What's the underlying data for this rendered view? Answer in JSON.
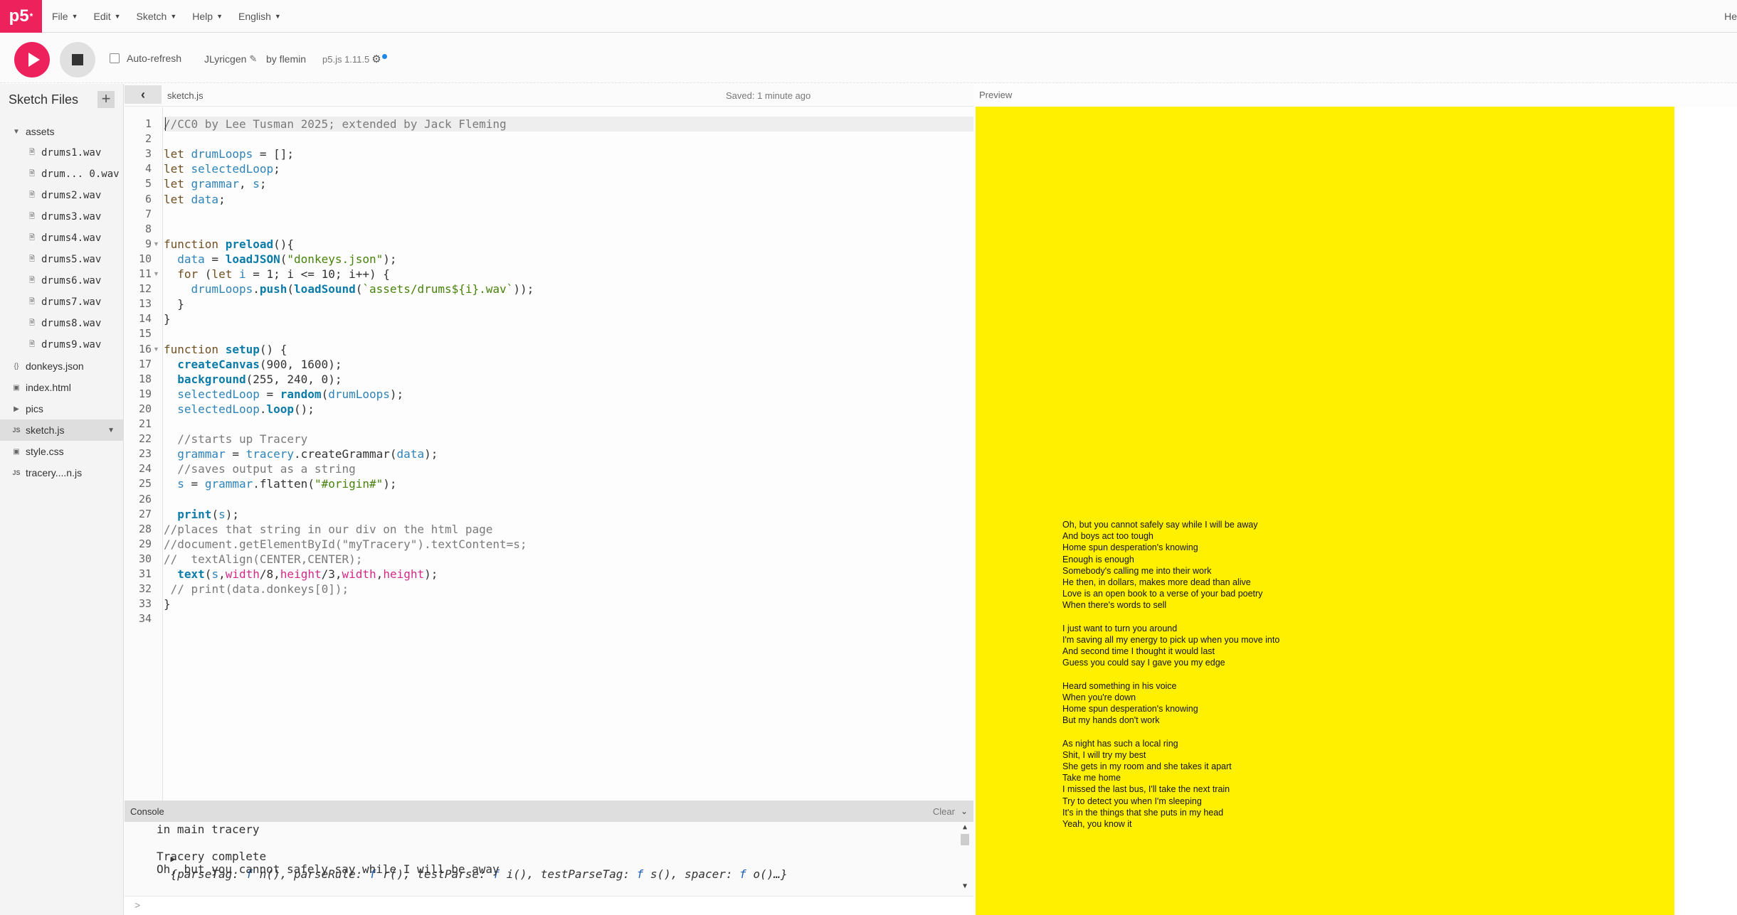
{
  "nav": {
    "logo": "p5",
    "logo_mark": "*",
    "menus": [
      "File",
      "Edit",
      "Sketch",
      "Help",
      "English"
    ],
    "right_text": "He"
  },
  "toolbar": {
    "autorefresh_label": "Auto-refresh",
    "sketch_name": "JLyricgen",
    "by_author": "by flemin",
    "version": "p5.js 1.11.5"
  },
  "sidebar": {
    "title": "Sketch Files",
    "add_label": "+",
    "files": [
      {
        "name": "assets",
        "type": "folder-open",
        "indent": 0
      },
      {
        "name": "drums1.wav",
        "type": "file",
        "indent": 1
      },
      {
        "name": "drum... 0.wav",
        "type": "file",
        "indent": 1
      },
      {
        "name": "drums2.wav",
        "type": "file",
        "indent": 1
      },
      {
        "name": "drums3.wav",
        "type": "file",
        "indent": 1
      },
      {
        "name": "drums4.wav",
        "type": "file",
        "indent": 1
      },
      {
        "name": "drums5.wav",
        "type": "file",
        "indent": 1
      },
      {
        "name": "drums6.wav",
        "type": "file",
        "indent": 1
      },
      {
        "name": "drums7.wav",
        "type": "file",
        "indent": 1
      },
      {
        "name": "drums8.wav",
        "type": "file",
        "indent": 1
      },
      {
        "name": "drums9.wav",
        "type": "file",
        "indent": 1
      },
      {
        "name": "donkeys.json",
        "type": "json",
        "indent": 0
      },
      {
        "name": "index.html",
        "type": "html",
        "indent": 0
      },
      {
        "name": "pics",
        "type": "folder-closed",
        "indent": 0
      },
      {
        "name": "sketch.js",
        "type": "js",
        "indent": 0,
        "selected": true
      },
      {
        "name": "style.css",
        "type": "css",
        "indent": 0
      },
      {
        "name": "tracery....n.js",
        "type": "js",
        "indent": 0
      }
    ]
  },
  "editor": {
    "tab": "sketch.js",
    "saved_status": "Saved: 1 minute ago",
    "active_line": 1,
    "fold_lines": [
      9,
      11,
      16
    ],
    "lines": [
      [
        [
          "cm",
          "//CC0 by Lee Tusman 2025; extended by Jack Fleming"
        ]
      ],
      [],
      [
        [
          "kw",
          "let "
        ],
        [
          "var",
          "drumLoops"
        ],
        [
          "plain",
          " = [];"
        ]
      ],
      [
        [
          "kw",
          "let "
        ],
        [
          "var",
          "selectedLoop"
        ],
        [
          "plain",
          ";"
        ]
      ],
      [
        [
          "kw",
          "let "
        ],
        [
          "var",
          "grammar"
        ],
        [
          "plain",
          ", "
        ],
        [
          "var",
          "s"
        ],
        [
          "plain",
          ";"
        ]
      ],
      [
        [
          "kw",
          "let "
        ],
        [
          "var",
          "data"
        ],
        [
          "plain",
          ";"
        ]
      ],
      [],
      [],
      [
        [
          "kw",
          "function "
        ],
        [
          "fn",
          "preload"
        ],
        [
          "plain",
          "(){"
        ]
      ],
      [
        [
          "plain",
          "  "
        ],
        [
          "var",
          "data"
        ],
        [
          "plain",
          " = "
        ],
        [
          "fn",
          "loadJSON"
        ],
        [
          "plain",
          "("
        ],
        [
          "str",
          "\"donkeys.json\""
        ],
        [
          "plain",
          ");"
        ]
      ],
      [
        [
          "plain",
          "  "
        ],
        [
          "kw",
          "for "
        ],
        [
          "plain",
          "("
        ],
        [
          "kw",
          "let "
        ],
        [
          "var",
          "i"
        ],
        [
          "plain",
          " = 1; i <= 10; i++) {"
        ]
      ],
      [
        [
          "plain",
          "    "
        ],
        [
          "var",
          "drumLoops"
        ],
        [
          "plain",
          "."
        ],
        [
          "fn",
          "push"
        ],
        [
          "plain",
          "("
        ],
        [
          "fn",
          "loadSound"
        ],
        [
          "plain",
          "("
        ],
        [
          "str",
          "`assets/drums${i}.wav`"
        ],
        [
          "plain",
          "));"
        ]
      ],
      [
        [
          "plain",
          "  }"
        ]
      ],
      [
        [
          "plain",
          "}"
        ]
      ],
      [],
      [
        [
          "kw",
          "function "
        ],
        [
          "fn",
          "setup"
        ],
        [
          "plain",
          "() {"
        ]
      ],
      [
        [
          "plain",
          "  "
        ],
        [
          "fn",
          "createCanvas"
        ],
        [
          "plain",
          "(900, 1600);"
        ]
      ],
      [
        [
          "plain",
          "  "
        ],
        [
          "fn",
          "background"
        ],
        [
          "plain",
          "(255, 240, 0);"
        ]
      ],
      [
        [
          "plain",
          "  "
        ],
        [
          "var",
          "selectedLoop"
        ],
        [
          "plain",
          " = "
        ],
        [
          "fn",
          "random"
        ],
        [
          "plain",
          "("
        ],
        [
          "var",
          "drumLoops"
        ],
        [
          "plain",
          ");"
        ]
      ],
      [
        [
          "plain",
          "  "
        ],
        [
          "var",
          "selectedLoop"
        ],
        [
          "plain",
          "."
        ],
        [
          "fn",
          "loop"
        ],
        [
          "plain",
          "();"
        ]
      ],
      [],
      [
        [
          "plain",
          "  "
        ],
        [
          "cm",
          "//starts up Tracery"
        ]
      ],
      [
        [
          "plain",
          "  "
        ],
        [
          "var",
          "grammar"
        ],
        [
          "plain",
          " = "
        ],
        [
          "var",
          "tracery"
        ],
        [
          "plain",
          ".createGrammar("
        ],
        [
          "var",
          "data"
        ],
        [
          "plain",
          ");"
        ]
      ],
      [
        [
          "plain",
          "  "
        ],
        [
          "cm",
          "//saves output as a string"
        ]
      ],
      [
        [
          "plain",
          "  "
        ],
        [
          "var",
          "s"
        ],
        [
          "plain",
          " = "
        ],
        [
          "var",
          "grammar"
        ],
        [
          "plain",
          ".flatten("
        ],
        [
          "str",
          "\"#origin#\""
        ],
        [
          "plain",
          ");"
        ]
      ],
      [],
      [
        [
          "plain",
          "  "
        ],
        [
          "fn",
          "print"
        ],
        [
          "plain",
          "("
        ],
        [
          "var",
          "s"
        ],
        [
          "plain",
          ");"
        ]
      ],
      [
        [
          "cm",
          "//places that string in our div on the html page"
        ]
      ],
      [
        [
          "cm",
          "//document.getElementById(\"myTracery\").textContent=s;"
        ]
      ],
      [
        [
          "cm",
          "//  textAlign(CENTER,CENTER);"
        ]
      ],
      [
        [
          "plain",
          "  "
        ],
        [
          "fn",
          "text"
        ],
        [
          "plain",
          "("
        ],
        [
          "var",
          "s"
        ],
        [
          "plain",
          ","
        ],
        [
          "pink",
          "width"
        ],
        [
          "plain",
          "/8,"
        ],
        [
          "pink",
          "height"
        ],
        [
          "plain",
          "/3,"
        ],
        [
          "pink",
          "width"
        ],
        [
          "plain",
          ","
        ],
        [
          "pink",
          "height"
        ],
        [
          "plain",
          ");"
        ]
      ],
      [
        [
          "plain",
          " "
        ],
        [
          "cm",
          "// print(data.donkeys[0]);"
        ]
      ],
      [
        [
          "plain",
          "}"
        ]
      ],
      []
    ]
  },
  "console": {
    "title": "Console",
    "clear_label": "Clear",
    "line1": "in main tracery",
    "obj_open": "{",
    "obj_items": [
      {
        "key": "parseTag",
        "fname": "n()"
      },
      {
        "key": "parseRule",
        "fname": "r()"
      },
      {
        "key": "testParse",
        "fname": "i()"
      },
      {
        "key": "testParseTag",
        "fname": "s()"
      },
      {
        "key": "spacer",
        "fname": "o()…}"
      }
    ],
    "line3": "Tracery complete",
    "line4": "Oh, but you cannot safely say while I will be away",
    "prompt": ">"
  },
  "preview": {
    "label": "Preview",
    "canvas_color": "#fff000",
    "lyrics": [
      "Oh, but you cannot safely say while I will be away",
      "And boys act too tough",
      "Home spun desperation's knowing",
      "Enough is enough",
      "Somebody's calling me into their work",
      "He then, in dollars, makes more dead than alive",
      "Love is an open book to a verse of your bad poetry",
      "When there's words to sell",
      "",
      "I just want to turn you around",
      "I'm saving all my energy to pick up when you move into",
      "And second time I thought it would last",
      "Guess you could say I gave you my edge",
      "",
      "Heard something in his voice",
      "When you're down",
      "Home spun desperation's knowing",
      "But my hands don't work",
      "",
      "As night has such a local ring",
      "Shit, I will try my best",
      "She gets in my room and she takes it apart",
      "Take me home",
      "I missed the last bus, I'll take the next train",
      "Try to detect you when I'm sleeping",
      "It's in the things that she puts in my head",
      "Yeah, you know it"
    ]
  },
  "colors": {
    "accent": "#ed225d",
    "canvas": "#fff000",
    "version_dot": "#1e88e5"
  }
}
